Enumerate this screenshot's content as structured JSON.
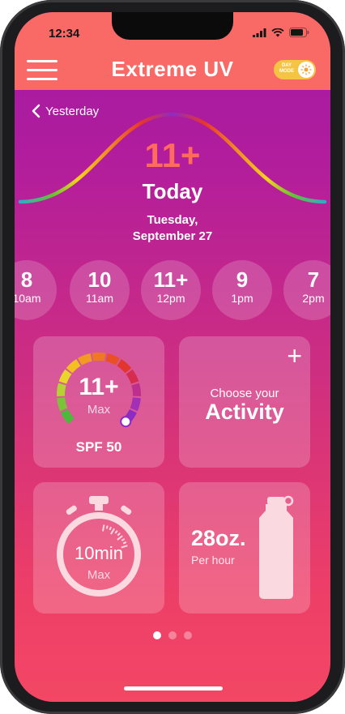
{
  "status_bar": {
    "time": "12:34"
  },
  "header": {
    "title": "Extreme UV",
    "toggle_label": "DAY MODE"
  },
  "nav": {
    "back_label": "Yesterday"
  },
  "summary": {
    "uv_index": "11+",
    "day": "Today",
    "date_line1": "Tuesday,",
    "date_line2": "September 27"
  },
  "hours": [
    {
      "value": "8",
      "time": "10am"
    },
    {
      "value": "10",
      "time": "11am"
    },
    {
      "value": "11+",
      "time": "12pm"
    },
    {
      "value": "9",
      "time": "1pm"
    },
    {
      "value": "7",
      "time": "2pm"
    }
  ],
  "uv_card": {
    "value": "11+",
    "max_label": "Max",
    "spf": "SPF 50",
    "gauge_fraction": 1.0
  },
  "activity_card": {
    "prompt": "Choose your",
    "title": "Activity"
  },
  "timer_card": {
    "value": "10min",
    "max_label": "Max"
  },
  "water_card": {
    "amount": "28oz.",
    "rate": "Per hour"
  },
  "pager": {
    "count": 3,
    "active": 0
  },
  "colors": {
    "header": "#f96a66",
    "accent_uv": "#ff6b5c",
    "gradient_top": "#a019a6",
    "gradient_bottom": "#f34765"
  }
}
